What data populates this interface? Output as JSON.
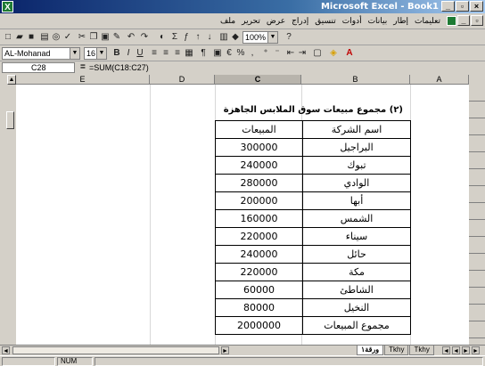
{
  "window": {
    "title": "Microsoft Excel - Book1"
  },
  "menu": [
    "ملف",
    "تحرير",
    "عرض",
    "إدراج",
    "تنسيق",
    "أدوات",
    "بيانات",
    "إطار",
    "تعليمات"
  ],
  "toolbar": {
    "font_name": "AL-Mohanad",
    "font_size": "16",
    "zoom": "100%"
  },
  "formula_bar": {
    "cell_ref": "C28",
    "equals": "=",
    "formula": "=SUM(C18:C27)"
  },
  "columns": [
    "E",
    "D",
    "C",
    "B",
    "A"
  ],
  "table": {
    "title": "(٢) مجموع مبيعات سوق الملابس الجاهزة",
    "header_company": "اسم الشركة",
    "header_sales": "المبيعات",
    "rows": [
      {
        "company": "البراجيل",
        "sales": "300000"
      },
      {
        "company": "تبوك",
        "sales": "240000"
      },
      {
        "company": "الوادي",
        "sales": "280000"
      },
      {
        "company": "أبها",
        "sales": "200000"
      },
      {
        "company": "الشمس",
        "sales": "160000"
      },
      {
        "company": "سيناء",
        "sales": "220000"
      },
      {
        "company": "حائل",
        "sales": "240000"
      },
      {
        "company": "مكة",
        "sales": "220000"
      },
      {
        "company": "الشاطئ",
        "sales": "60000"
      },
      {
        "company": "النخيل",
        "sales": "80000"
      }
    ],
    "total_label": "مجموع المبيعات",
    "total_value": "2000000"
  },
  "sheet_tabs": [
    "ورقة١",
    "Tkhy",
    "Tkhy"
  ],
  "status": {
    "mode": "NUM"
  }
}
